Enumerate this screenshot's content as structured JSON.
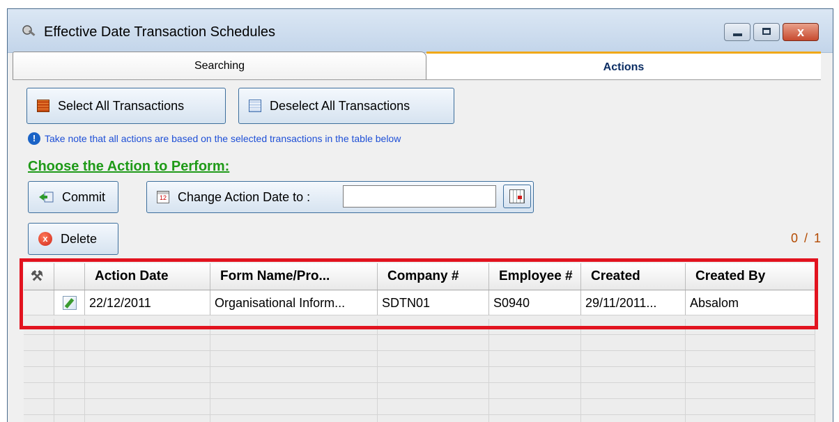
{
  "window": {
    "title": "Effective Date Transaction Schedules",
    "close_glyph": "x"
  },
  "tabs": [
    {
      "label": "Searching",
      "active": false
    },
    {
      "label": "Actions",
      "active": true
    }
  ],
  "buttons": {
    "select_all": "Select All Transactions",
    "deselect_all": "Deselect All Transactions",
    "commit": "Commit",
    "change_date": "Change Action Date to :",
    "delete": "Delete"
  },
  "info": {
    "icon_glyph": "!",
    "text": "Take note that all actions are based on the selected transactions in the table below"
  },
  "heading": "Choose the Action to Perform:",
  "date_input": {
    "value": ""
  },
  "calendar_icon_glyph": "12",
  "delete_icon_glyph": "x",
  "counter": "0 / 1",
  "table": {
    "tools_glyph": "⚒",
    "columns": [
      "",
      "",
      "Action Date",
      "Form Name/Pro...",
      "Company #",
      "Employee #",
      "Created",
      "Created By"
    ],
    "rows": [
      [
        "",
        "",
        "22/12/2011",
        "Organisational Inform...",
        "SDTN01",
        "S0940",
        "29/11/2011...",
        "Absalom"
      ]
    ]
  },
  "colors": {
    "heading": "#1f9a18",
    "info_text": "#1e4fd6",
    "active_tab_accent": "#f0a818",
    "highlight": "#e2131f",
    "counter": "#b34a00"
  },
  "icons": [
    "app-icon",
    "minimize-icon",
    "maximize-icon",
    "close-icon",
    "select-grid-icon",
    "deselect-grid-icon",
    "info-icon",
    "commit-icon",
    "calendar-icon",
    "calendar-picker-icon",
    "delete-icon",
    "tools-icon",
    "edit-icon"
  ]
}
